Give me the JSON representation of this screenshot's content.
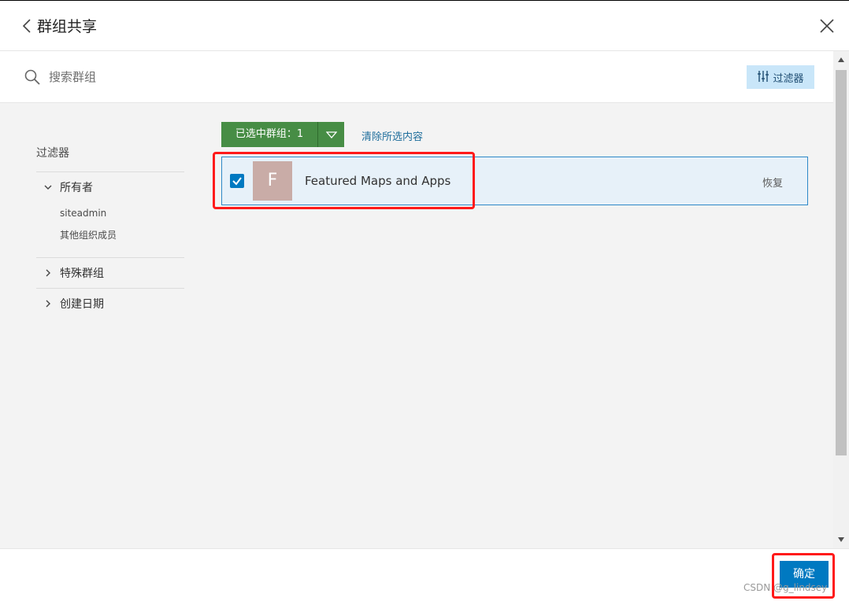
{
  "header": {
    "title": "群组共享"
  },
  "search": {
    "placeholder": "搜索群组",
    "filter_button_label": "过滤器"
  },
  "filters": {
    "title": "过滤器",
    "facets": [
      {
        "label": "所有者",
        "expanded": true,
        "items": [
          "siteadmin",
          "其他组织成员"
        ]
      },
      {
        "label": "特殊群组",
        "expanded": false
      },
      {
        "label": "创建日期",
        "expanded": false
      }
    ]
  },
  "selection": {
    "selected_label": "已选中群组：1",
    "clear_label": "清除所选内容"
  },
  "groups": [
    {
      "initial": "F",
      "name": "Featured Maps and Apps",
      "checked": true,
      "action_label": "恢复"
    }
  ],
  "footer": {
    "ok_label": "确定",
    "watermark": "CSDN @g_lindsey"
  },
  "colors": {
    "primary": "#0079c1",
    "selected_green": "#478d45",
    "filter_button_bg": "#c9e6f9",
    "highlight_red": "#ff1a1a",
    "thumb_bg": "#c9aca7"
  }
}
